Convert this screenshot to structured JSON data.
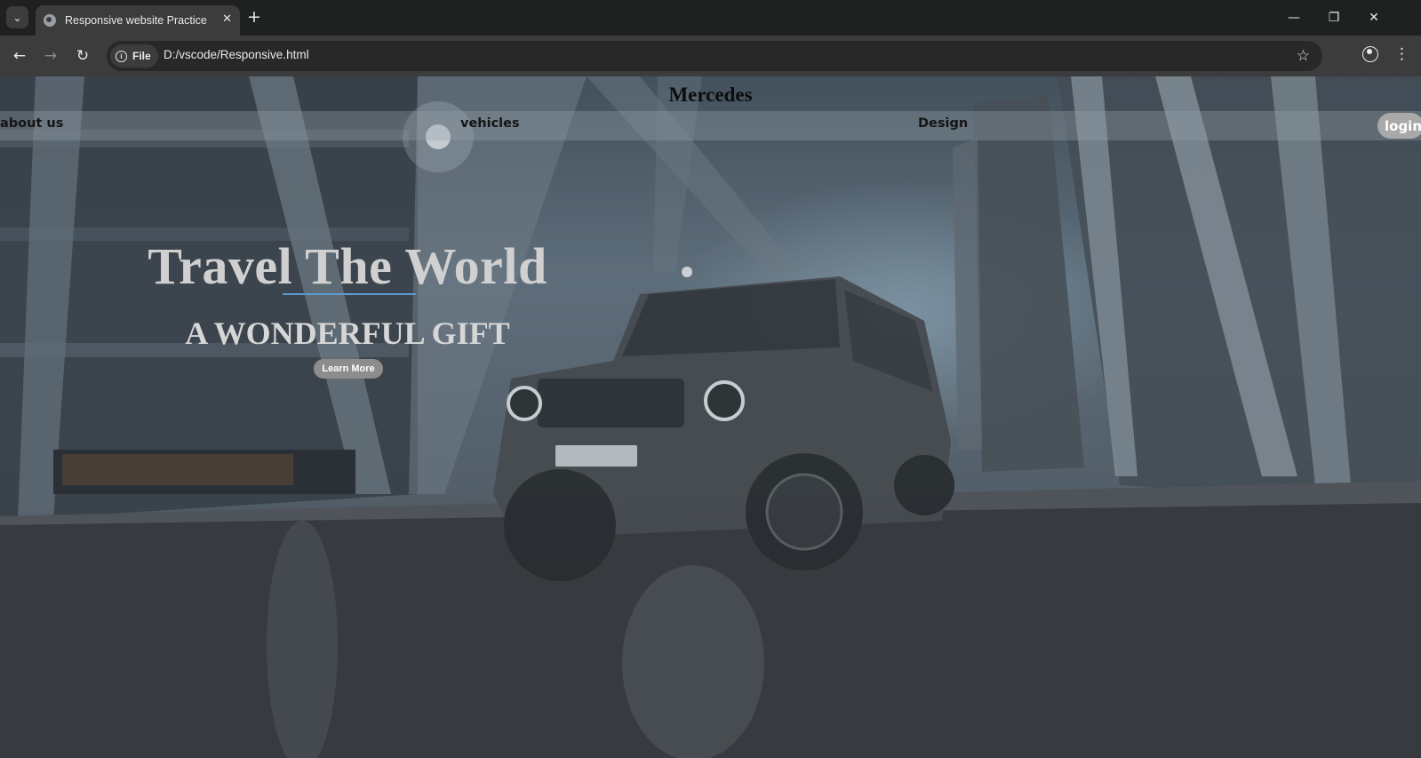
{
  "browser": {
    "tab": {
      "title": "Responsive website Practice"
    },
    "address": {
      "scheme_chip": "File",
      "url": "D:/vscode/Responsive.html"
    },
    "icons": {
      "tab_search": "chevron-down-icon",
      "new_tab": "plus-icon",
      "back": "arrow-left-icon",
      "forward": "arrow-right-icon",
      "reload": "reload-icon",
      "bookmark": "star-icon",
      "profile": "profile-icon",
      "menu": "kebab-menu-icon"
    }
  },
  "page": {
    "brand": "Mercedes",
    "nav": {
      "about": "about us",
      "vehicles": "vehicles",
      "design": "Design",
      "login": "login"
    },
    "hero": {
      "title": "Travel The World",
      "subtitle": "A WONDERFUL GIFT",
      "cta": "Learn More"
    },
    "background": "photo of a dark Mercedes G-Class SUV on wet pavement beneath steel structures at dusk",
    "colors": {
      "accent_line": "#5b9bd1",
      "navbar_overlay": "rgba(150,160,168,0.35)"
    }
  }
}
